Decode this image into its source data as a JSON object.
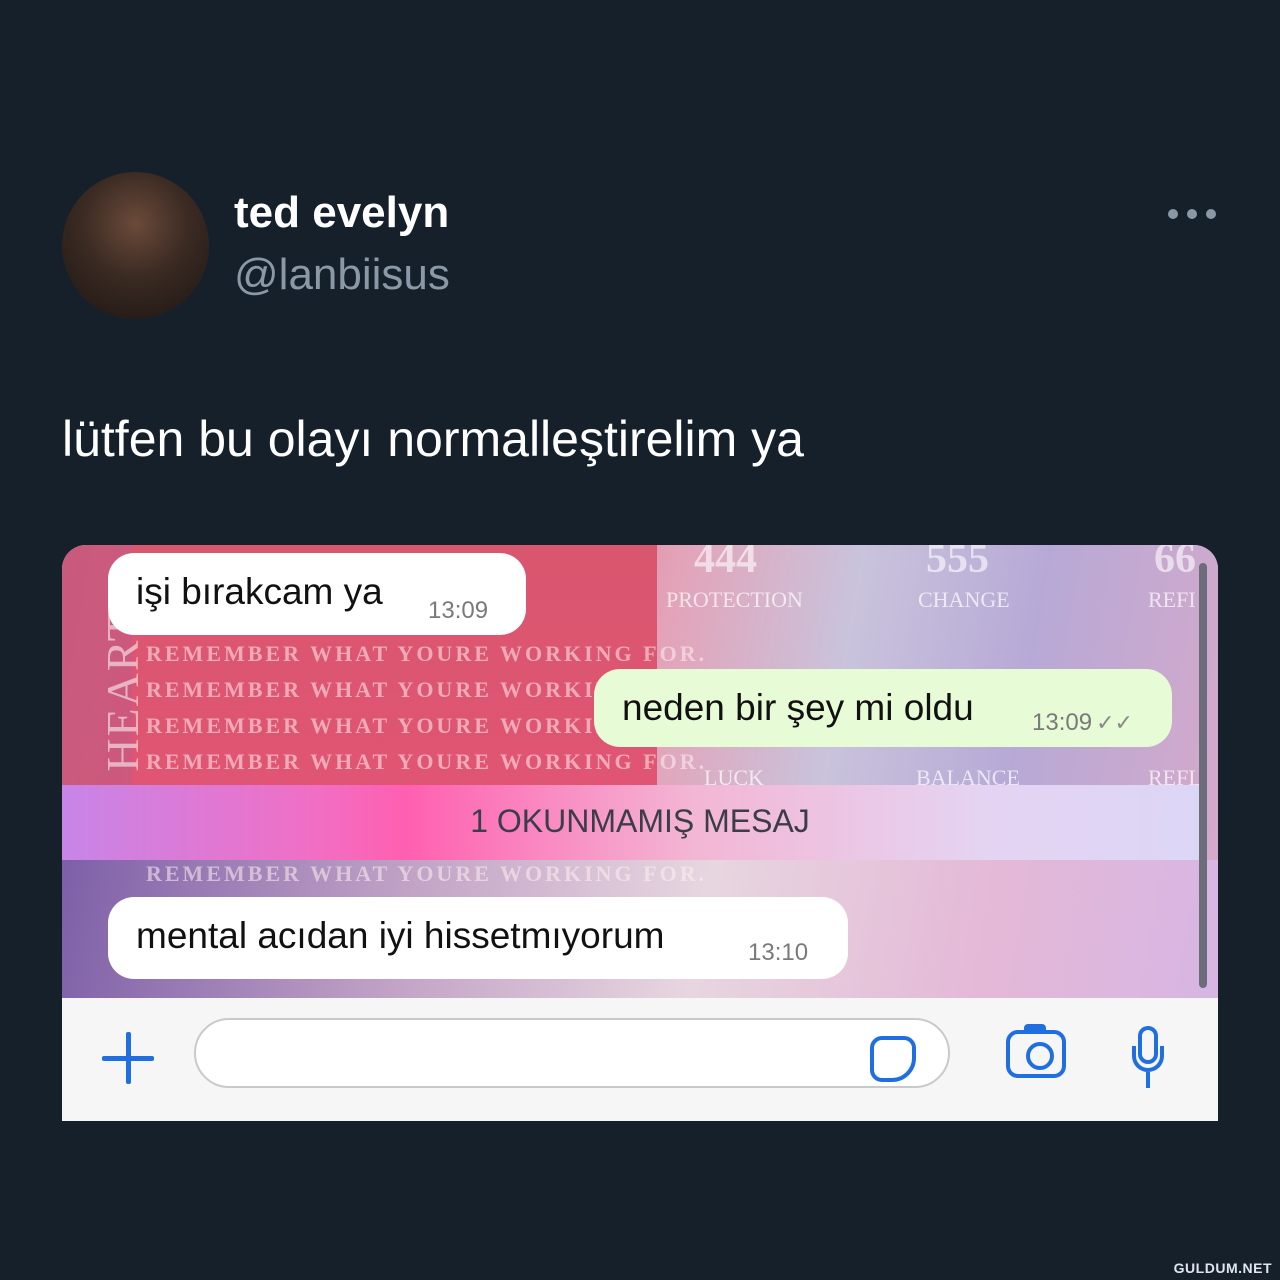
{
  "tweet": {
    "display_name": "ted evelyn",
    "handle": "@lanbiisus",
    "text": "lütfen bu olayı normalleştirelim ya"
  },
  "chat": {
    "messages": [
      {
        "direction": "incoming",
        "text": "işi bırakcam ya",
        "time": "13:09"
      },
      {
        "direction": "outgoing",
        "text": "neden bir şey mi oldu",
        "time": "13:09",
        "status": "read"
      },
      {
        "direction": "incoming",
        "text": "mental acıdan iyi hissetmıyorum",
        "time": "13:10"
      }
    ],
    "unread_divider": "1 OKUNMAMIŞ MESAJ",
    "input_placeholder": ""
  },
  "wallpaper": {
    "side_text": "HEART",
    "repeat_text": "REMEMBER WHAT YOURE WORKING FOR.",
    "numbers": [
      "444",
      "555",
      "66"
    ],
    "labels": [
      "PROTECTION",
      "CHANGE",
      "REFI",
      "LUCK",
      "BALANCE",
      "REFL"
    ]
  },
  "icons": [
    "more-icon",
    "plus-icon",
    "sticker-icon",
    "camera-icon",
    "mic-icon"
  ],
  "colors": {
    "background": "#15202b",
    "accent": "#1f6fe0",
    "outgoing_bubble": "#e7fbd7"
  },
  "watermark": "GULDUM.NET"
}
